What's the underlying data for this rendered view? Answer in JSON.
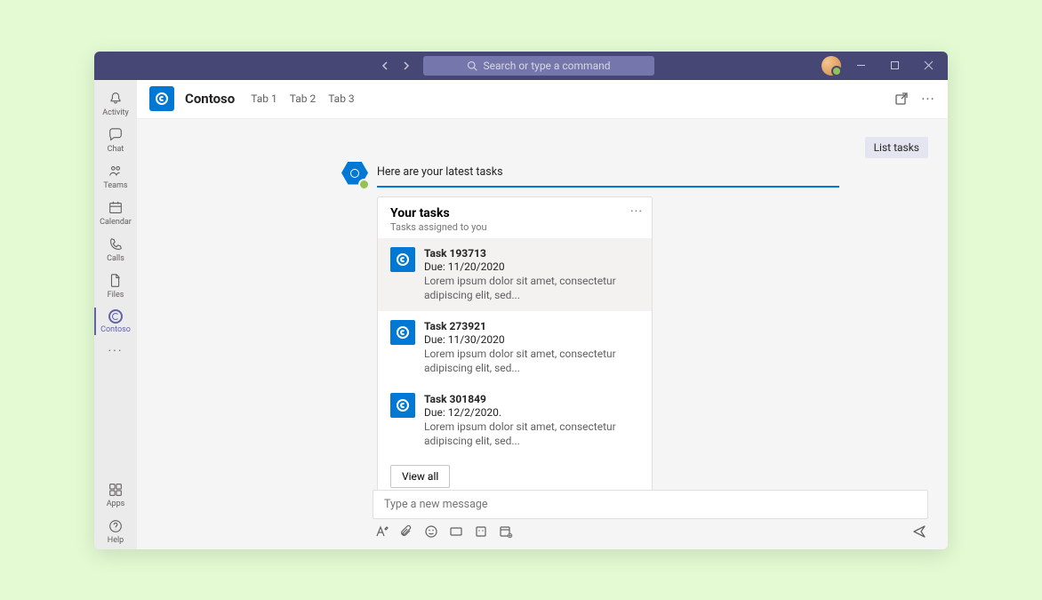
{
  "titlebar": {
    "search_placeholder": "Search or type a command"
  },
  "rail": {
    "items": [
      {
        "label": "Activity"
      },
      {
        "label": "Chat"
      },
      {
        "label": "Teams"
      },
      {
        "label": "Calendar"
      },
      {
        "label": "Calls"
      },
      {
        "label": "Files"
      },
      {
        "label": "Contoso"
      }
    ],
    "bottom": [
      {
        "label": "Apps"
      },
      {
        "label": "Help"
      }
    ]
  },
  "header": {
    "app_name": "Contoso",
    "tabs": [
      "Tab 1",
      "Tab 2",
      "Tab 3"
    ]
  },
  "echo": "List tasks",
  "bot": {
    "intro": "Here are your latest tasks",
    "card": {
      "title": "Your tasks",
      "subtitle": "Tasks assigned to you",
      "tasks": [
        {
          "name": "Task 193713",
          "due": "Due: 11/20/2020",
          "desc": "Lorem ipsum dolor sit amet, consectetur adipiscing elit, sed..."
        },
        {
          "name": "Task 273921",
          "due": "Due: 11/30/2020",
          "desc": "Lorem ipsum dolor sit amet, consectetur adipiscing elit, sed..."
        },
        {
          "name": "Task 301849",
          "due": "Due: 12/2/2020.",
          "desc": "Lorem ipsum dolor sit amet, consectetur adipiscing elit, sed..."
        }
      ],
      "view_all": "View all"
    }
  },
  "composer": {
    "placeholder": "Type a new message"
  }
}
